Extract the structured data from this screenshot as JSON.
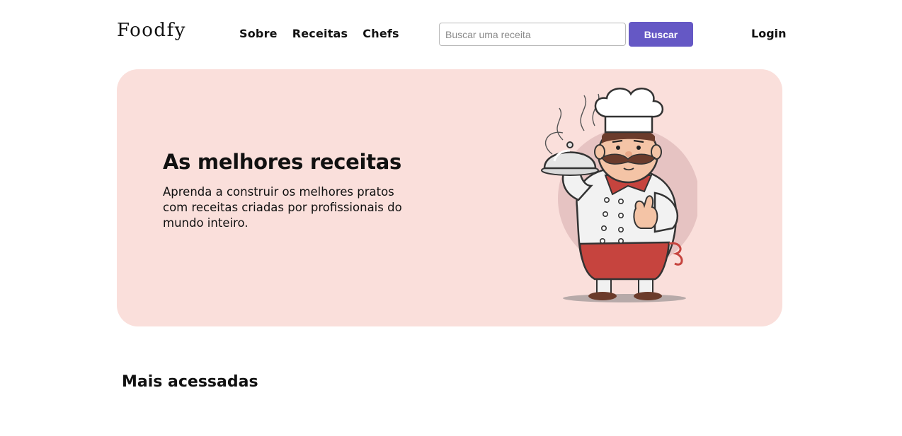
{
  "header": {
    "logo": "Foodfy",
    "nav": [
      "Sobre",
      "Receitas",
      "Chefs"
    ],
    "search": {
      "placeholder": "Buscar uma receita",
      "button": "Buscar"
    },
    "login": "Login"
  },
  "hero": {
    "title": "As melhores receitas",
    "text": "Aprenda a construir os melhores pratos com receitas criadas por profissionais do mundo inteiro."
  },
  "section": {
    "title": "Mais acessadas"
  },
  "colors": {
    "accent": "#6558c5",
    "hero_bg": "#fadfdb"
  }
}
